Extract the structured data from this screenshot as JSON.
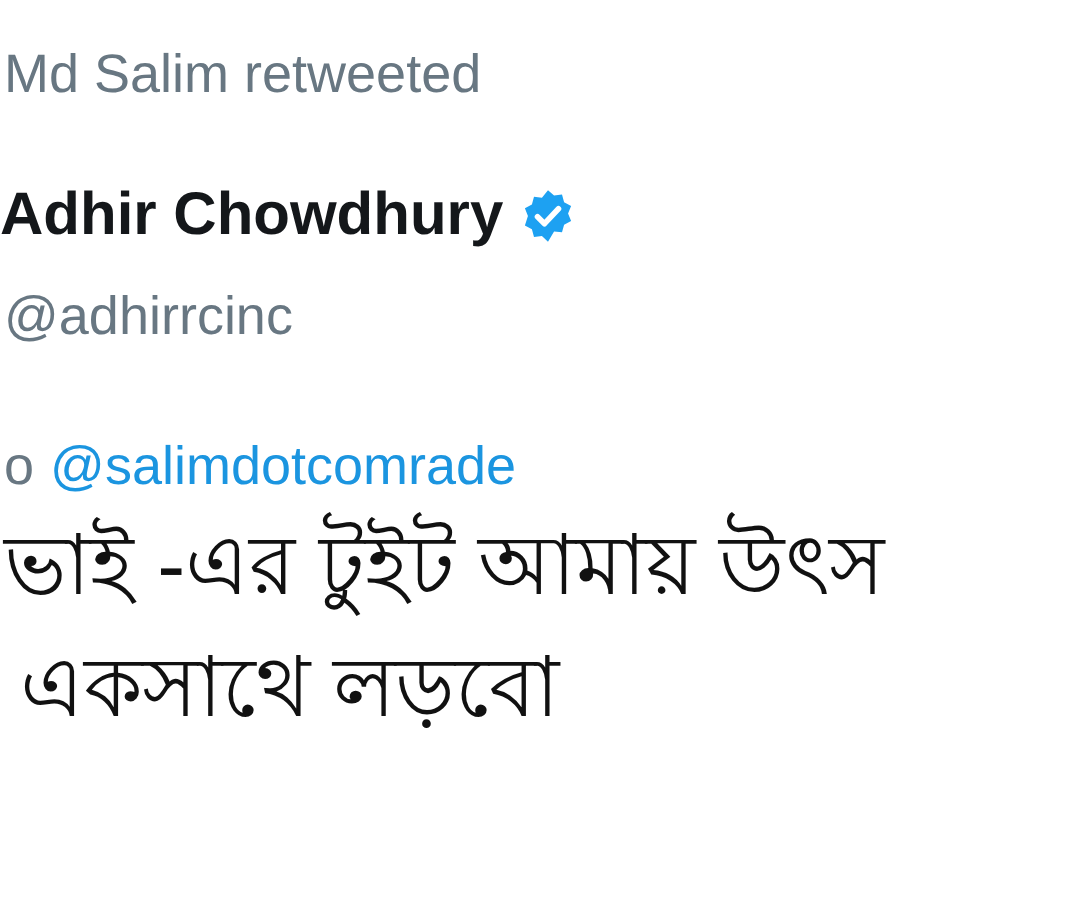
{
  "retweet_header": {
    "text": "Md Salim retweeted"
  },
  "author": {
    "name": "Adhir Chowdhury",
    "verified": true,
    "handle": "@adhirrcinc"
  },
  "reply_line": {
    "prefix": "o",
    "mention": "@salimdotcomrade"
  },
  "tweet_lines": [
    "ভাই -এর টুইট আমায় উৎস",
    "একসাথে লড়বো"
  ]
}
